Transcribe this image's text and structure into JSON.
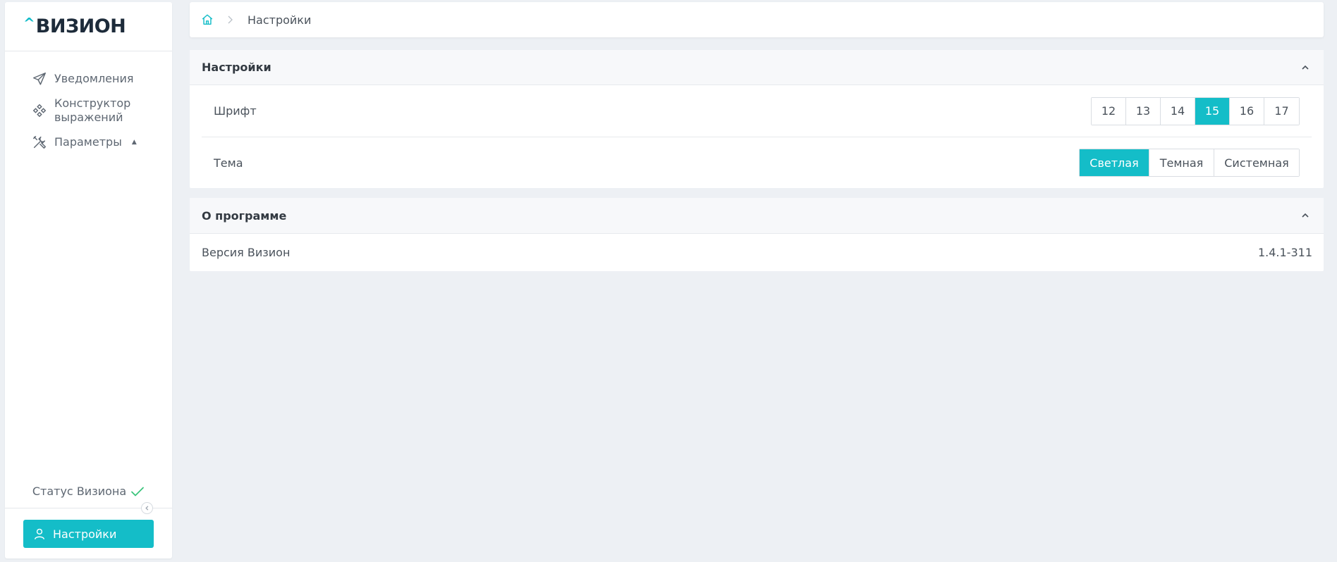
{
  "sidebar": {
    "logo_caret": "^",
    "logo_text": "ВИЗИОН",
    "items": [
      {
        "label": "Уведомления",
        "icon": "send-icon"
      },
      {
        "label": "Конструктор выражений",
        "icon": "diamond-grid-icon"
      },
      {
        "label": "Параметры",
        "icon": "tools-icon",
        "expanded_marker": "▲"
      }
    ],
    "status_label": "Статус Визиона",
    "settings_button_label": "Настройки"
  },
  "breadcrumb": {
    "current": "Настройки"
  },
  "settings_panel": {
    "title": "Настройки",
    "font_label": "Шрифт",
    "font_sizes": [
      "12",
      "13",
      "14",
      "15",
      "16",
      "17"
    ],
    "font_selected": "15",
    "theme_label": "Тема",
    "themes": [
      "Светлая",
      "Темная",
      "Системная"
    ],
    "theme_selected": "Светлая"
  },
  "about_panel": {
    "title": "О программе",
    "version_label": "Версия Визион",
    "version_value": "1.4.1-311"
  },
  "colors": {
    "accent": "#14bdc8",
    "status_ok": "#3cc47c",
    "background": "#edf0f4"
  }
}
